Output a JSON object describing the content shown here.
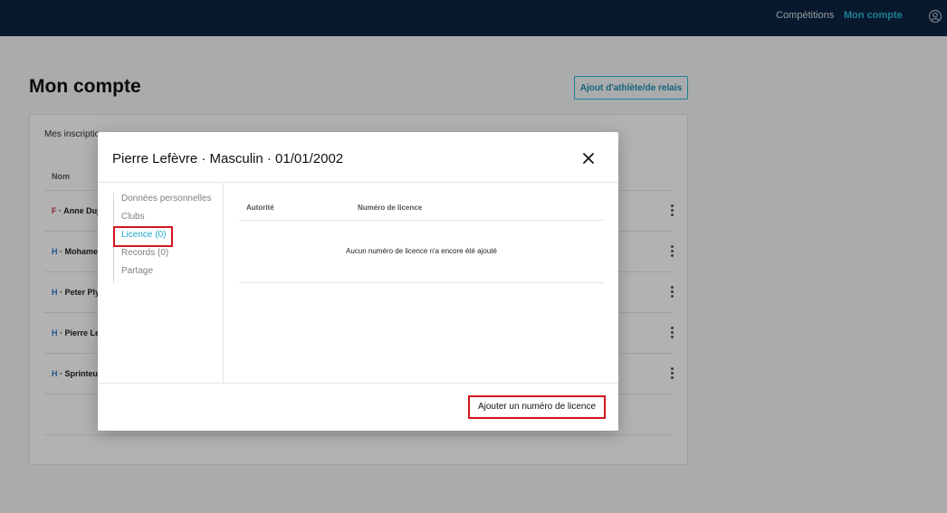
{
  "topbar": {
    "competitions": "Compétitions",
    "account": "Mon compte",
    "user_icon": "user-circle-icon"
  },
  "page": {
    "title": "Mon compte",
    "add_athlete_button": "Ajout d'athlète/de relais"
  },
  "card": {
    "tabs_text": "Mes inscriptio",
    "col_name": "Nom",
    "rows": [
      {
        "sex": "F",
        "name": "Anne Duj"
      },
      {
        "sex": "H",
        "name": "Mohame"
      },
      {
        "sex": "H",
        "name": "Peter Ply"
      },
      {
        "sex": "H",
        "name": "Pierre Le"
      },
      {
        "sex": "H",
        "name": "Sprinteu"
      }
    ]
  },
  "modal": {
    "title": "Pierre Lefèvre · Masculin · 01/01/2002",
    "close_icon": "close-icon",
    "sidebar": [
      "Données personnelles",
      "Clubs",
      "Licence (0)",
      "Records (0)",
      "Partage"
    ],
    "active_index": 2,
    "table": {
      "col_authority": "Autorité",
      "col_licence": "Numéro de licence",
      "empty_text": "Aucun numéro de licence n'a encore été ajouté"
    },
    "add_licence_button": "Ajouter un numéro de licence"
  },
  "colors": {
    "topbar_bg": "#0c2541",
    "accent": "#2bb7d6",
    "highlight_red": "#d1161e",
    "female": "#d2384b",
    "male": "#2b7dc9"
  }
}
